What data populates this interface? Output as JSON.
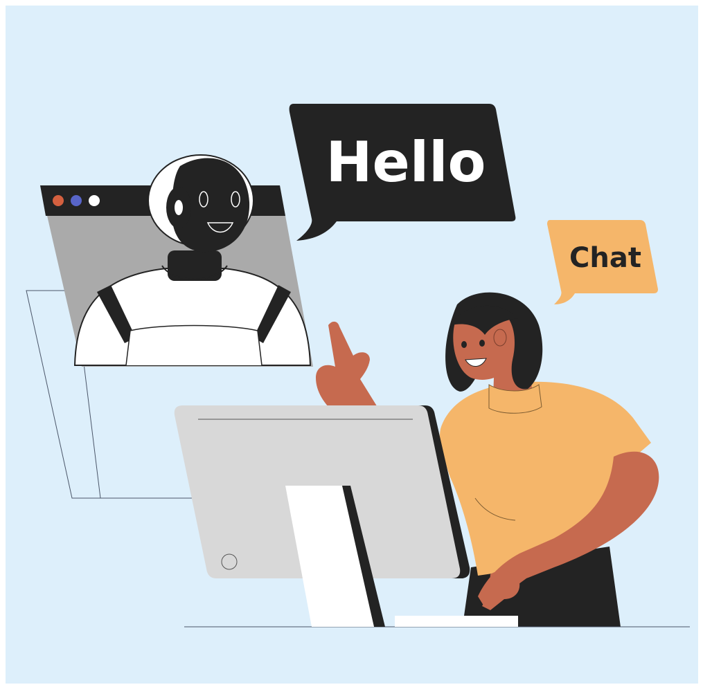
{
  "speech": {
    "hello": "Hello",
    "chat": "Chat"
  },
  "colors": {
    "background": "#ddeffb",
    "dark": "#232323",
    "bubble_orange": "#f5b66a",
    "skin": "#c66a4f",
    "shirt": "#f5b66a",
    "window_gray": "#aaaaaa",
    "monitor_gray": "#d8d8d8",
    "dot_red": "#d4603f",
    "dot_blue": "#5865c8",
    "dot_white": "#ffffff"
  }
}
